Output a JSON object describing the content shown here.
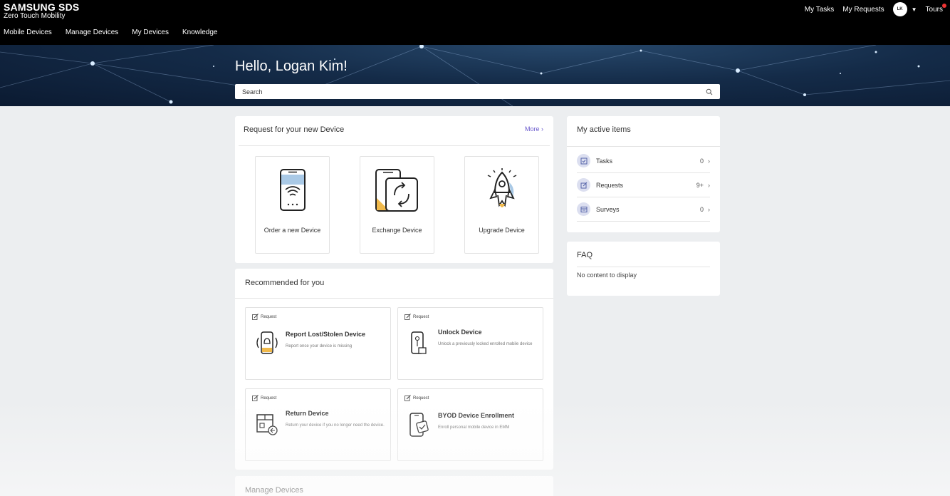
{
  "brand": {
    "main": "SAMSUNG SDS",
    "sub": "Zero Touch Mobility"
  },
  "nav": [
    "Mobile Devices",
    "Manage Devices",
    "My Devices",
    "Knowledge"
  ],
  "top_right": {
    "my_tasks": "My Tasks",
    "my_requests": "My Requests",
    "avatar": "LK",
    "tours": "Tours"
  },
  "hero": {
    "greeting": "Hello, Logan Kim!",
    "search_placeholder": "Search"
  },
  "request_card": {
    "title": "Request for your new Device",
    "more": "More ›",
    "tiles": [
      {
        "label": "Order a new Device",
        "icon": "phone-wifi-icon"
      },
      {
        "label": "Exchange Device",
        "icon": "exchange-device-icon"
      },
      {
        "label": "Upgrade Device",
        "icon": "rocket-icon"
      }
    ]
  },
  "recommended": {
    "title": "Recommended for you",
    "items": [
      {
        "tag": "Request",
        "title": "Report Lost/Stolen Device",
        "desc": "Report once your device is missing",
        "icon": "lost-device-icon"
      },
      {
        "tag": "Request",
        "title": "Unlock Device",
        "desc": "Unlock a previously locked enrolled mobile device",
        "icon": "unlock-device-icon"
      },
      {
        "tag": "Request",
        "title": "Return Device",
        "desc": "Return your device if you no longer need the device.",
        "icon": "return-device-icon"
      },
      {
        "tag": "Request",
        "title": "BYOD Device Enrollment",
        "desc": "Enroll personal mobile device in EMM",
        "icon": "byod-icon"
      }
    ]
  },
  "manage_card": {
    "title": "Manage Devices"
  },
  "active_items": {
    "title": "My active items",
    "rows": [
      {
        "label": "Tasks",
        "count": "0",
        "icon": "task-check-icon"
      },
      {
        "label": "Requests",
        "count": "9+",
        "icon": "request-edit-icon"
      },
      {
        "label": "Surveys",
        "count": "0",
        "icon": "survey-icon"
      }
    ]
  },
  "faq": {
    "title": "FAQ",
    "empty": "No content to display"
  },
  "colors": {
    "topbar": "#000000",
    "accent": "#6a5acd",
    "hero": "#142b48",
    "icon_bg": "#dcdff0"
  }
}
